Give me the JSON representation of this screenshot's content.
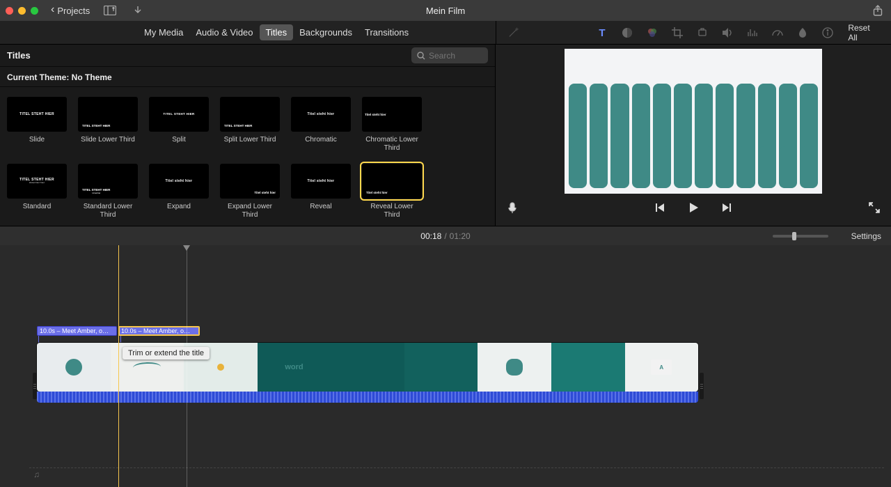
{
  "toolbar": {
    "projects_label": "Projects",
    "project_title": "Mein Film"
  },
  "library": {
    "tabs": [
      "My Media",
      "Audio & Video",
      "Titles",
      "Backgrounds",
      "Transitions"
    ],
    "active_tab": 2,
    "reset_all": "Reset All"
  },
  "browser": {
    "heading": "Titles",
    "search_placeholder": "Search",
    "theme_label": "Current Theme: No Theme",
    "titles": [
      {
        "name": "Slide",
        "style": "center",
        "text": "TITEL STEHT HIER"
      },
      {
        "name": "Slide Lower Third",
        "style": "lower",
        "text": "TITEL STEHT HIER"
      },
      {
        "name": "Split",
        "style": "center-small",
        "text": "TITEL STEHT HIER"
      },
      {
        "name": "Split Lower Third",
        "style": "lower",
        "text": "TITEL STEHT HIER"
      },
      {
        "name": "Chromatic",
        "style": "center",
        "text": "Titel steht hier"
      },
      {
        "name": "Chromatic Lower Third",
        "style": "left",
        "text": "Titel steht hier"
      },
      {
        "name": "Standard",
        "style": "center-sub",
        "text": "TITEL STEHT HIER"
      },
      {
        "name": "Standard Lower Third",
        "style": "lower-sub",
        "text": "TITEL STEHT HIER"
      },
      {
        "name": "Expand",
        "style": "center",
        "text": "Titel steht hier"
      },
      {
        "name": "Expand Lower Third",
        "style": "right-lower",
        "text": "Titel steht hier"
      },
      {
        "name": "Reveal",
        "style": "center",
        "text": "Titel steht hier"
      },
      {
        "name": "Reveal Lower Third",
        "style": "lower",
        "text": "Titel steht hier",
        "selected": true
      }
    ]
  },
  "time": {
    "current": "00:18",
    "total": "01:20",
    "settings": "Settings"
  },
  "timeline": {
    "title_clip_1": "10.0s – Meet Amber, o…",
    "title_clip_2": "10.0s – Meet Amber, o…",
    "tooltip": "Trim or extend the title",
    "word_frame": "word",
    "a_frame": "A"
  }
}
